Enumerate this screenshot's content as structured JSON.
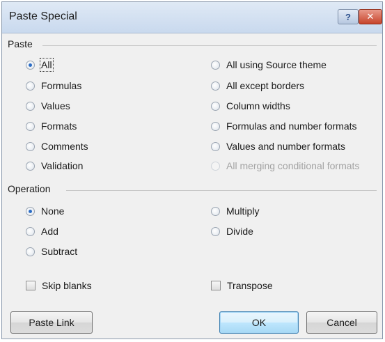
{
  "dialog": {
    "title": "Paste Special",
    "help_glyph": "?",
    "close_glyph": "✕"
  },
  "paste": {
    "label": "Paste",
    "left_options": [
      {
        "label": "All",
        "checked": true
      },
      {
        "label": "Formulas",
        "checked": false
      },
      {
        "label": "Values",
        "checked": false
      },
      {
        "label": "Formats",
        "checked": false
      },
      {
        "label": "Comments",
        "checked": false
      },
      {
        "label": "Validation",
        "checked": false
      }
    ],
    "right_options": [
      {
        "label": "All using Source theme",
        "disabled": false
      },
      {
        "label": "All except borders",
        "disabled": false
      },
      {
        "label": "Column widths",
        "disabled": false
      },
      {
        "label": "Formulas and number formats",
        "disabled": false
      },
      {
        "label": "Values and number formats",
        "disabled": false
      },
      {
        "label": "All merging conditional formats",
        "disabled": true
      }
    ]
  },
  "operation": {
    "label": "Operation",
    "left_options": [
      {
        "label": "None",
        "checked": true
      },
      {
        "label": "Add",
        "checked": false
      },
      {
        "label": "Subtract",
        "checked": false
      }
    ],
    "right_options": [
      {
        "label": "Multiply",
        "checked": false
      },
      {
        "label": "Divide",
        "checked": false
      }
    ]
  },
  "checkboxes": {
    "skip_blanks": {
      "label": "Skip blanks",
      "checked": false
    },
    "transpose": {
      "label": "Transpose",
      "checked": false
    }
  },
  "buttons": {
    "paste_link": "Paste Link",
    "ok": "OK",
    "cancel": "Cancel"
  },
  "colors": {
    "selected_radio": "#2b6cc4",
    "disabled_text": "#a3a3a3"
  }
}
